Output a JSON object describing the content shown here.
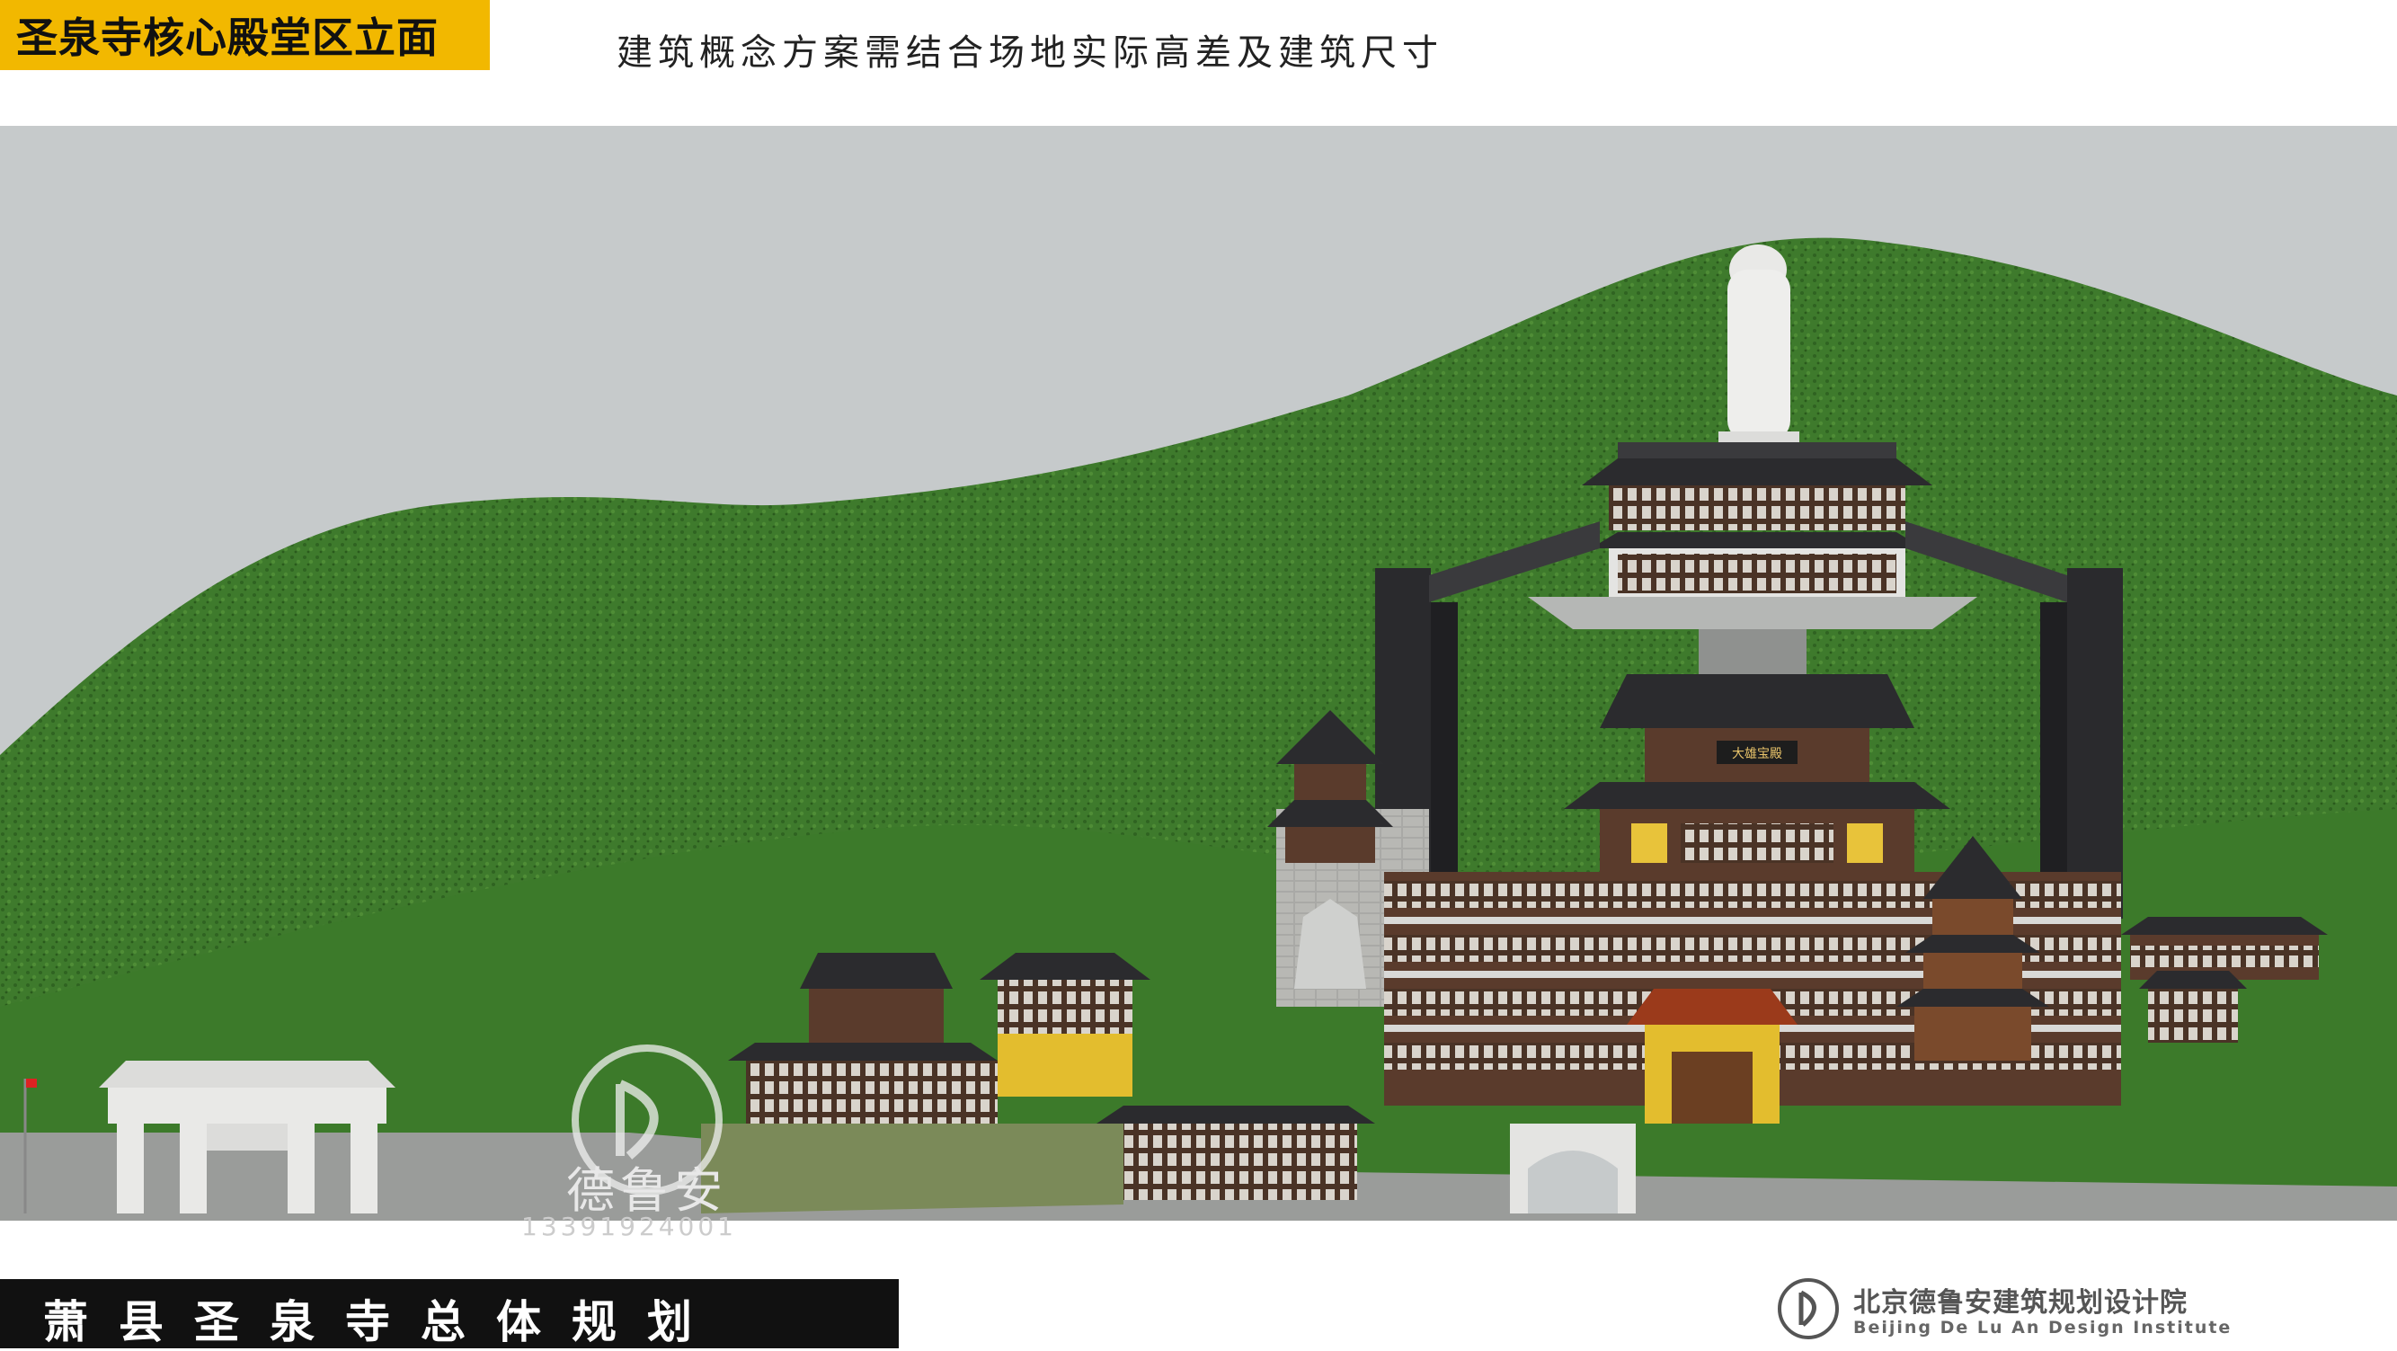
{
  "header": {
    "title": "圣泉寺核心殿堂区立面",
    "subtitle": "建筑概念方案需结合场地实际高差及建筑尺寸"
  },
  "footer": {
    "project_title": "萧县圣泉寺总体规划",
    "org_name": "北京德鲁安建筑规划设计院",
    "org_name_en": "Beijing De Lu An Design Institute"
  },
  "watermark": {
    "text": "德鲁安",
    "number": "13391924001"
  },
  "scene": {
    "hall_plaque": "大雄宝殿",
    "sky_color": "#c7cbcc",
    "hill_color": "#3f7a2a"
  },
  "icons": {
    "org_logo": "boat-sail-logo-icon",
    "watermark_logo": "boat-sail-logo-icon"
  }
}
